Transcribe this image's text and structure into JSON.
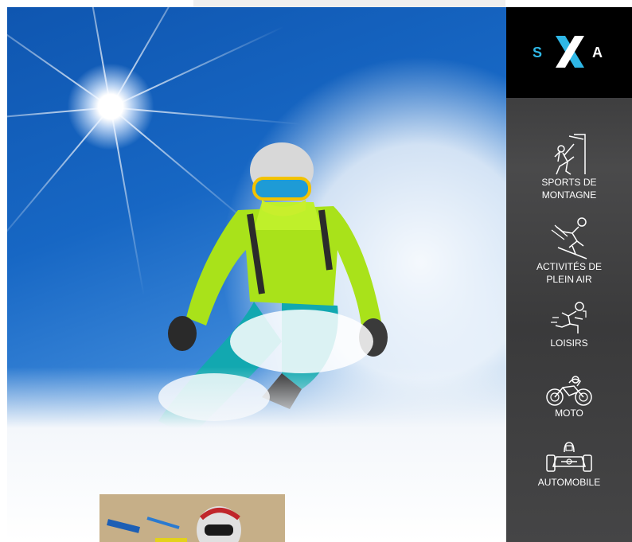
{
  "brand": {
    "logo_left": "S",
    "logo_right": "A",
    "accent_color": "#2fb7e6"
  },
  "hero": {
    "image_description_icon": "skier-photo"
  },
  "sidebar": {
    "items": [
      {
        "label": "SPORTS DE\nMONTAGNE",
        "icon": "climber-icon"
      },
      {
        "label": "ACTIVITÉS DE\nPLEIN AIR",
        "icon": "skier-icon"
      },
      {
        "label": "LOISIRS",
        "icon": "runner-icon"
      },
      {
        "label": "MOTO",
        "icon": "motorcycle-icon"
      },
      {
        "label": "AUTOMOBILE",
        "icon": "kart-icon"
      }
    ]
  }
}
